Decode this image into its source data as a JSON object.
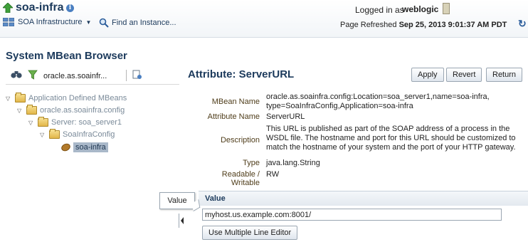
{
  "header": {
    "app_title": "soa-infra",
    "logged_in_label": "Logged in as",
    "user": "weblogic",
    "menu_label": "SOA Infrastructure",
    "find_link": "Find an Instance...",
    "refresh_label": "Page Refreshed",
    "refresh_date": "Sep 25, 2013 9:01:37 AM PDT"
  },
  "left": {
    "title": "System MBean Browser",
    "toolbar_label": "oracle.as.soainfr...",
    "tree": [
      {
        "label": "Application Defined MBeans",
        "level": 0,
        "kind": "folder"
      },
      {
        "label": "oracle.as.soainfra.config",
        "level": 1,
        "kind": "folder"
      },
      {
        "label": "Server: soa_server1",
        "level": 2,
        "kind": "folder"
      },
      {
        "label": "SoaInfraConfig",
        "level": 3,
        "kind": "folder"
      },
      {
        "label": "soa-infra",
        "level": 4,
        "kind": "bean",
        "selected": true
      }
    ]
  },
  "right": {
    "title": "Attribute: ServerURL",
    "buttons": {
      "apply": "Apply",
      "revert": "Revert",
      "return": "Return"
    },
    "props": {
      "mbean_name_label": "MBean Name",
      "mbean_name_line1": "oracle.as.soainfra.config:Location=soa_server1,name=soa-infra,",
      "mbean_name_line2": "type=SoaInfraConfig,Application=soa-infra",
      "attr_name_label": "Attribute Name",
      "attr_name": "ServerURL",
      "desc_label": "Description",
      "desc_line1": "This URL is published as part of the SOAP address of a process in the",
      "desc_line2": "WSDL file. The hostname and port for this URL should be customized to",
      "desc_line3": "match the hostname of your system and the port of your HTTP gateway.",
      "type_label": "Type",
      "type": "java.lang.String",
      "rw_label": "Readable / Writable",
      "rw": "RW"
    },
    "value_section": {
      "title": "Value",
      "tooltip": "Value",
      "input_value": "myhost.us.example.com:8001/",
      "multiline_button": "Use Multiple Line Editor"
    }
  },
  "icons": {
    "app": "green-up-arrow-icon",
    "info": "info-icon",
    "server": "server-icon",
    "soa": "soa-infrastructure-icon",
    "search": "search-icon",
    "refresh": "refresh-icon",
    "binoculars": "binoculars-icon",
    "filter": "filter-icon",
    "export": "export-icon"
  }
}
